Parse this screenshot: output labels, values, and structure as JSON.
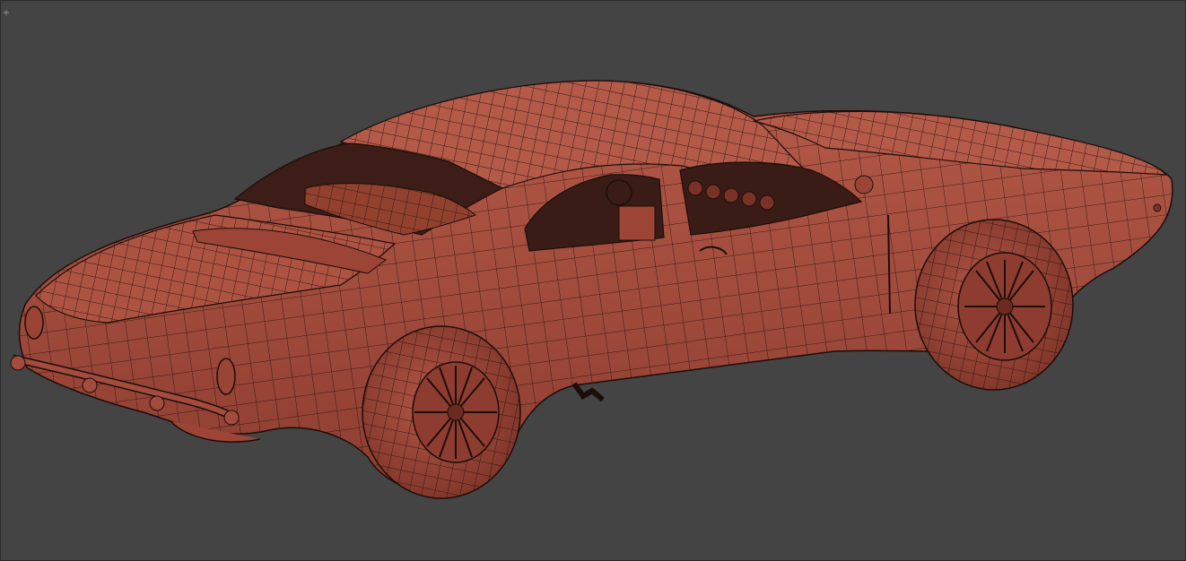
{
  "viewport": {
    "corner_menu_glyph": "+",
    "background_color": "#444444",
    "model_color": "#a24a3c",
    "wire_color": "#1b0d0a",
    "model_name": "car-wireframe-model"
  }
}
